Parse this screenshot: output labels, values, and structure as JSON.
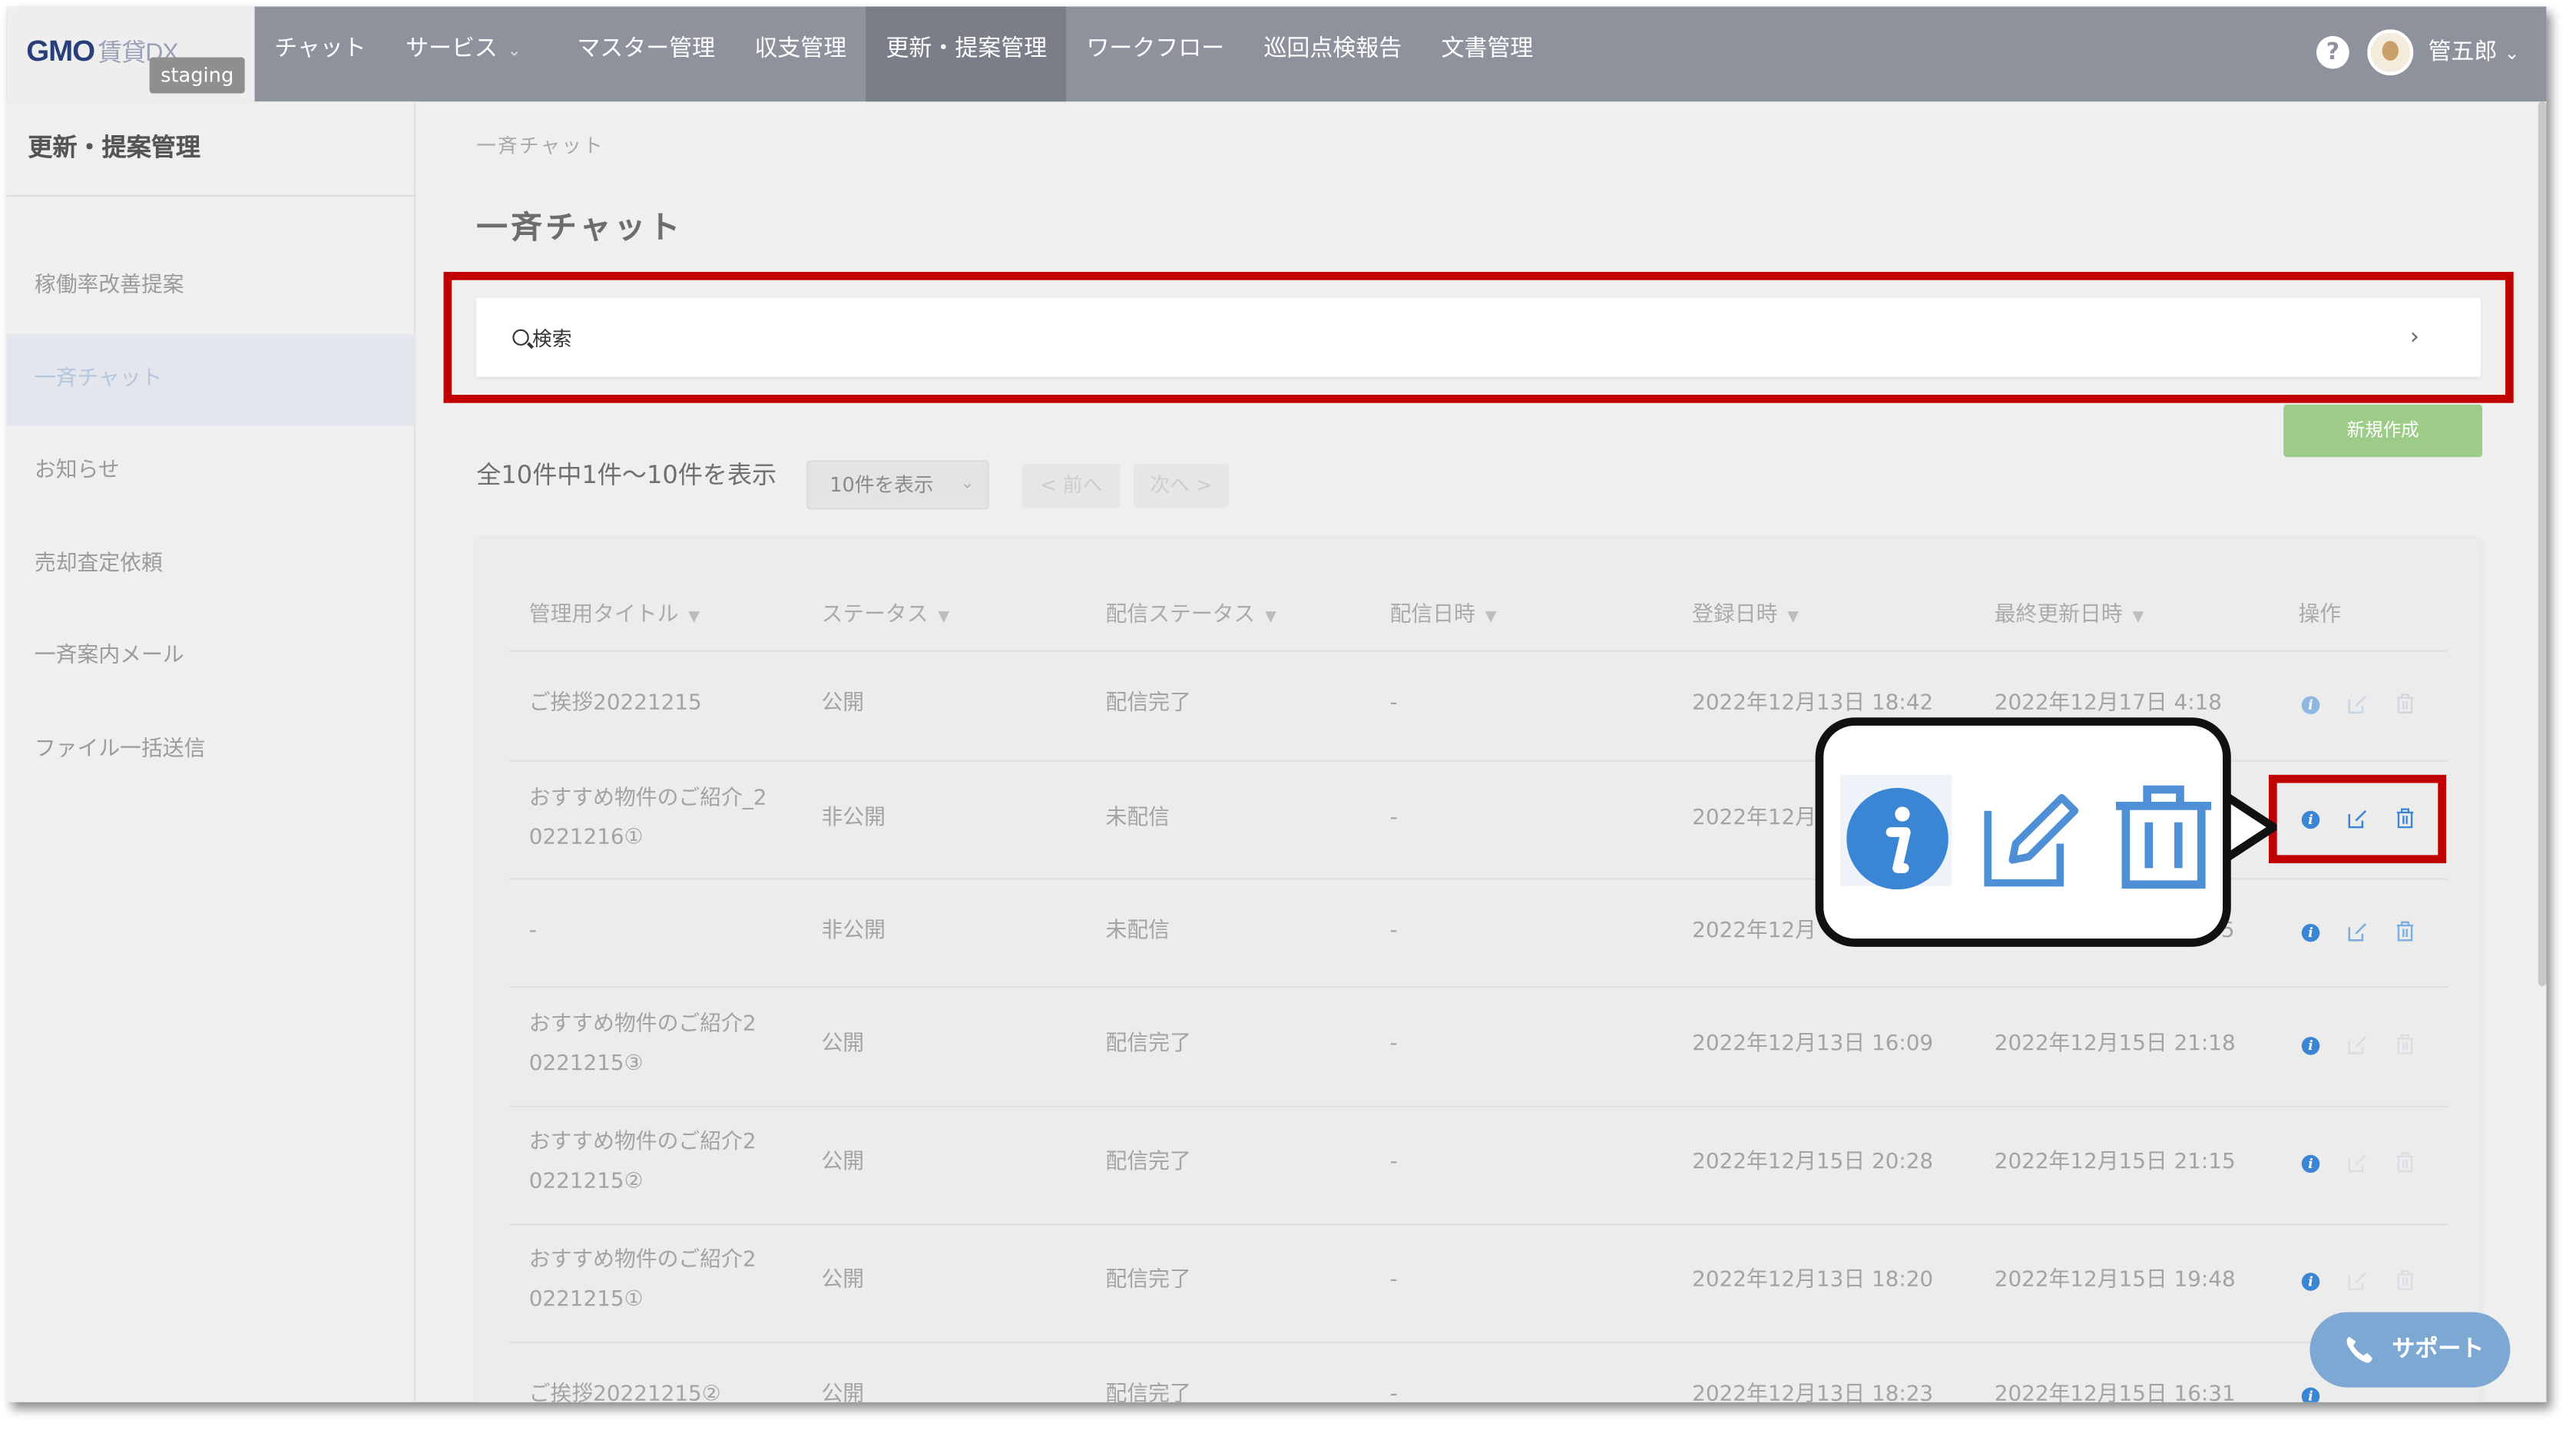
{
  "brand": {
    "logo": "GMO",
    "logo_sub": "賃貸DX",
    "env_badge": "staging"
  },
  "nav": [
    {
      "label": "チャット",
      "dropdown": false
    },
    {
      "label": "サービス",
      "dropdown": true
    },
    {
      "label": "マスター管理",
      "dropdown": false
    },
    {
      "label": "収支管理",
      "dropdown": false
    },
    {
      "label": "更新・提案管理",
      "dropdown": false,
      "active": true
    },
    {
      "label": "ワークフロー",
      "dropdown": false
    },
    {
      "label": "巡回点検報告",
      "dropdown": false
    },
    {
      "label": "文書管理",
      "dropdown": false
    }
  ],
  "user": {
    "name": "管五郎",
    "help_icon": "?"
  },
  "sidebar": {
    "title": "更新・提案管理",
    "items": [
      {
        "label": "稼働率改善提案"
      },
      {
        "label": "一斉チャット",
        "active": true
      },
      {
        "label": "お知らせ"
      },
      {
        "label": "売却査定依頼"
      },
      {
        "label": "一斉案内メール"
      },
      {
        "label": "ファイル一括送信"
      }
    ]
  },
  "main": {
    "breadcrumb": "一斉チャット",
    "title": "一斉チャット",
    "search_label": "検索",
    "new_button": "新規作成",
    "count_text": "全10件中1件～10件を表示",
    "per_page": "10件を表示",
    "prev": "< 前へ",
    "next": "次へ >"
  },
  "table": {
    "headers": [
      "管理用タイトル",
      "ステータス",
      "配信ステータス",
      "配信日時",
      "登録日時",
      "最終更新日時",
      "操作"
    ],
    "rows": [
      {
        "title": [
          "ご挨拶20221215"
        ],
        "status": "公開",
        "delivery": "配信完了",
        "sent": "-",
        "created": "2022年12月13日 18:42",
        "updated": "2022年12月17日 4:18"
      },
      {
        "title": [
          "おすすめ物件のご紹介_2",
          "0221216①"
        ],
        "status": "非公開",
        "delivery": "未配信",
        "sent": "-",
        "created": "2022年12月",
        "updated": ""
      },
      {
        "title": [
          "-"
        ],
        "status": "非公開",
        "delivery": "未配信",
        "sent": "-",
        "created": "2022年12月",
        "updated": "5"
      },
      {
        "title": [
          "おすすめ物件のご紹介2",
          "0221215③"
        ],
        "status": "公開",
        "delivery": "配信完了",
        "sent": "-",
        "created": "2022年12月13日 16:09",
        "updated": "2022年12月15日 21:18"
      },
      {
        "title": [
          "おすすめ物件のご紹介2",
          "0221215②"
        ],
        "status": "公開",
        "delivery": "配信完了",
        "sent": "-",
        "created": "2022年12月15日 20:28",
        "updated": "2022年12月15日 21:15"
      },
      {
        "title": [
          "おすすめ物件のご紹介2",
          "0221215①"
        ],
        "status": "公開",
        "delivery": "配信完了",
        "sent": "-",
        "created": "2022年12月13日 18:20",
        "updated": "2022年12月15日 19:48"
      },
      {
        "title": [
          "ご挨拶20221215②"
        ],
        "status": "公開",
        "delivery": "配信完了",
        "sent": "-",
        "created": "2022年12月13日 18:23",
        "updated": "2022年12月15日 16:31"
      }
    ]
  },
  "support": {
    "label": "サポート"
  },
  "colors": {
    "highlight": "#c00000",
    "topbar": "#8e929c",
    "accent": "#3a86d4",
    "new_button": "#9ccc88"
  },
  "icons": [
    "info-icon",
    "edit-icon",
    "trash-icon",
    "search-icon",
    "chevron-right-icon",
    "phone-icon",
    "help-icon"
  ]
}
